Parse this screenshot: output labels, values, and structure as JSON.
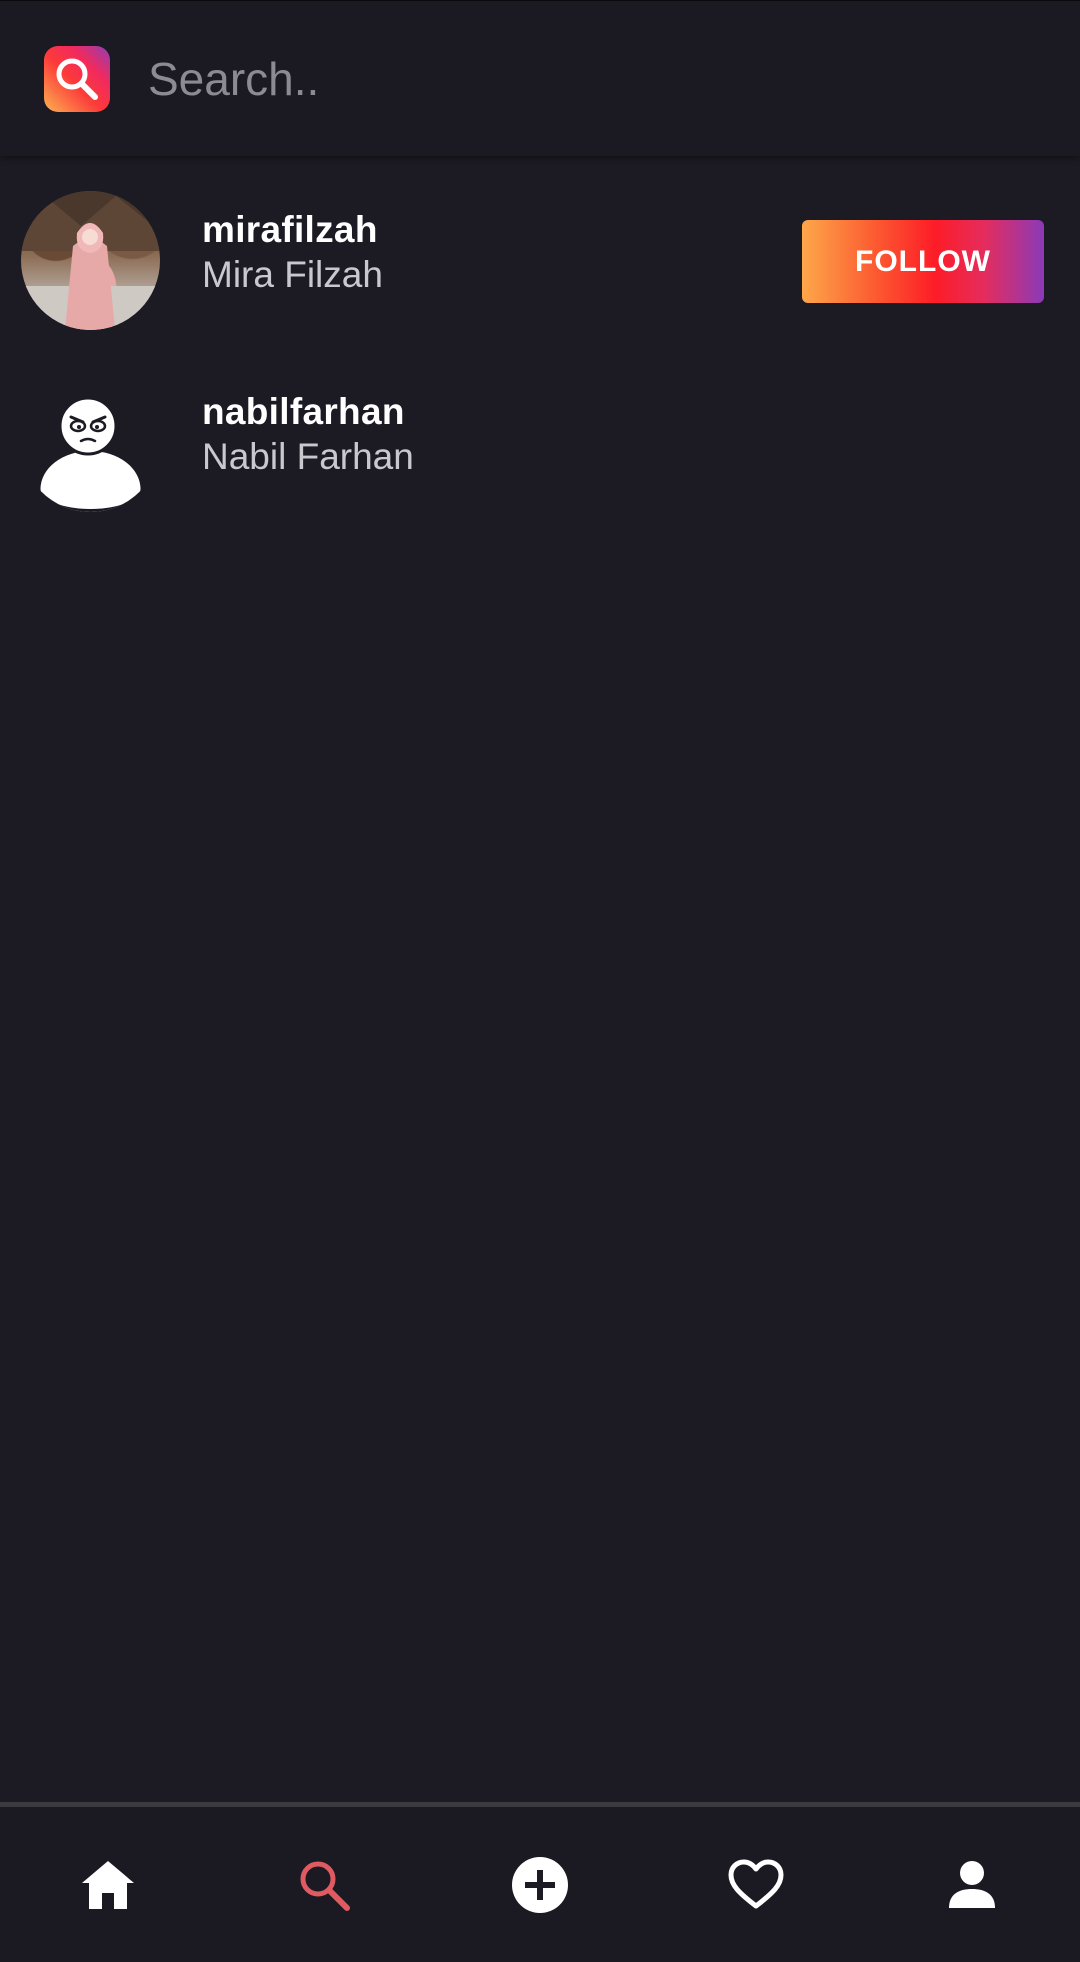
{
  "search": {
    "placeholder": "Search..",
    "value": ""
  },
  "users": [
    {
      "username": "mirafilzah",
      "full_name": "Mira Filzah",
      "follow_label": ""
    },
    {
      "username": "nabilfarhan",
      "full_name": "Nabil Farhan",
      "follow_label": "FOLLOW"
    }
  ],
  "bottom_nav": {
    "items": [
      {
        "icon": "home-icon",
        "active": false
      },
      {
        "icon": "search-icon",
        "active": true
      },
      {
        "icon": "add-circle-icon",
        "active": false
      },
      {
        "icon": "heart-icon",
        "active": false
      },
      {
        "icon": "person-icon",
        "active": false
      }
    ]
  },
  "colors": {
    "background": "#1c1b23",
    "active_tab": "#e05a62",
    "inactive_tab": "#ffffff",
    "gradient_start": "#fda74a",
    "gradient_mid": "#fd1c27",
    "gradient_end": "#8b3ab8"
  }
}
